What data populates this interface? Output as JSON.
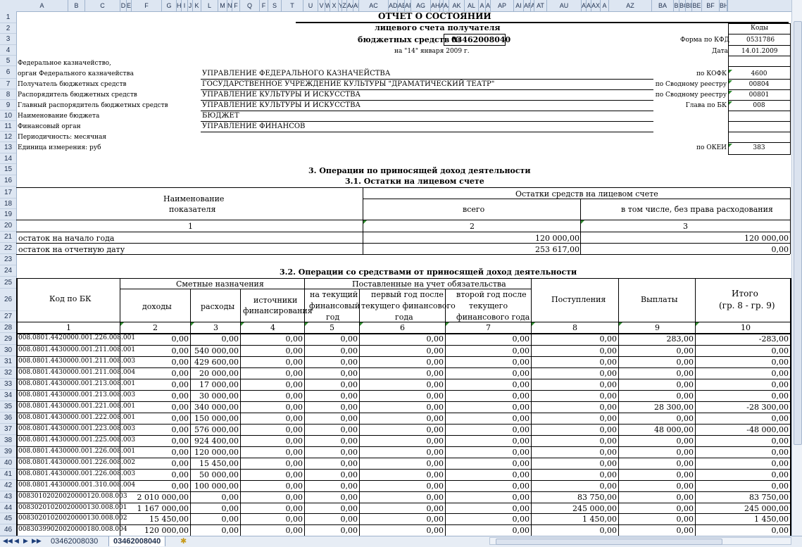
{
  "columns": [
    "A",
    "B",
    "C",
    "D",
    "E",
    "F",
    "G",
    "H",
    "I",
    "J",
    "K",
    "L",
    "M",
    "N",
    "F",
    "Q",
    "F",
    "S",
    "T",
    "U",
    "V",
    "W",
    "X",
    "Y",
    "Z",
    "AA",
    "AB",
    "AC",
    "AD",
    "AE",
    "AF",
    "AG",
    "AH",
    "AI",
    "AJ",
    "AK",
    "AL",
    "A",
    "AI",
    "AP",
    "AI",
    "AR",
    "A",
    "AT",
    "AU",
    "AV",
    "AW",
    "AX",
    "A",
    "AZ",
    "BA",
    "B",
    "BC",
    "BD",
    "BE",
    "BF",
    "BH",
    "BI"
  ],
  "rows": [
    "1",
    "2",
    "3",
    "4",
    "5",
    "6",
    "7",
    "8",
    "9",
    "10",
    "11",
    "12",
    "13",
    "14",
    "15",
    "16",
    "17",
    "18",
    "19",
    "20",
    "21",
    "22",
    "23",
    "24",
    "25",
    "26",
    "27",
    "28",
    "29",
    "30",
    "31",
    "32",
    "33",
    "34",
    "35",
    "36",
    "37",
    "38",
    "39",
    "40",
    "41",
    "42",
    "43",
    "44",
    "45",
    "46"
  ],
  "header": {
    "title": "ОТЧЕТ О СОСТОЯНИИ",
    "subtitle": "лицевого счета получателя",
    "account_label": "бюджетных средств №",
    "account_number": "03462008040",
    "date_line": "на \"14\" января 2009 г.",
    "codes_label": "Коды",
    "form_label": "Форма по КФД",
    "form_code": "0531786",
    "date_label": "Дата",
    "date_value": "14.01.2009"
  },
  "info": [
    {
      "label": "Федеральное казначейство,",
      "value": "",
      "code_label": "",
      "code": ""
    },
    {
      "label": "орган Федерального казначейства",
      "value": "УПРАВЛЕНИЕ ФЕДЕРАЛЬНОГО КАЗНАЧЕЙСТВА",
      "code_label": "по КОФК",
      "code": "4600"
    },
    {
      "label": "Получатель бюджетных средств",
      "value": "ГОСУДАРСТВЕННОЕ УЧРЕЖДЕНИЕ КУЛЬТУРЫ \"ДРАМАТИЧЕСКИЙ ТЕАТР\"",
      "code_label": "по Сводному реестру",
      "code": "00804"
    },
    {
      "label": "Распорядитель бюджетных средств",
      "value": "УПРАВЛЕНИЕ КУЛЬТУРЫ И ИСКУССТВА",
      "code_label": "по Сводному реестру",
      "code": "00801"
    },
    {
      "label": "Главный распорядитель бюджетных средств",
      "value": "УПРАВЛЕНИЕ КУЛЬТУРЫ И ИСКУССТВА",
      "code_label": "Глава по БК",
      "code": "008"
    },
    {
      "label": "Наименование бюджета",
      "value": "БЮДЖЕТ",
      "code_label": "",
      "code": ""
    },
    {
      "label": "Финансовый орган",
      "value": "УПРАВЛЕНИЕ ФИНАНСОВ",
      "code_label": "",
      "code": ""
    },
    {
      "label": "Периодичность: месячная",
      "value": "",
      "code_label": "",
      "code": ""
    },
    {
      "label": "Единица измерения: руб",
      "value": "",
      "code_label": "по ОКЕИ",
      "code": "383"
    }
  ],
  "section3": {
    "title": "3. Операции по приносящей доход деятельности",
    "sub31": "3.1. Остатки на лицевом счете",
    "name_header_1": "Наименование",
    "name_header_2": "показателя",
    "balances_header": "Остатки средств на лицевом счете",
    "total_header": "всего",
    "restricted_header": "в том числе, без права расходования",
    "col_nums": [
      "1",
      "2",
      "3"
    ],
    "rows": [
      {
        "label": "остаток на начало года",
        "total": "120 000,00",
        "restricted": "120 000,00"
      },
      {
        "label": "остаток на отчетную дату",
        "total": "253 617,00",
        "restricted": "0,00"
      }
    ]
  },
  "section32": {
    "title": "3.2. Операции со средствами от приносящей доход деятельности",
    "code_header": "Код по БК",
    "estimate_header": "Сметные назначения",
    "obligations_header": "Поставленные на учет обязательства",
    "income_header": "доходы",
    "expenses_header": "расходы",
    "sources_header_1": "источники",
    "sources_header_2": "финансирования",
    "cur_year_1": "на текущий",
    "cur_year_2": "финансовый",
    "cur_year_3": "год",
    "first_year_1": "первый год после",
    "first_year_2": "текущего финансового",
    "first_year_3": "года",
    "second_year_1": "второй год после",
    "second_year_2": "текущего",
    "second_year_3": "финансового года",
    "receipts_header": "Поступления",
    "payments_header": "Выплаты",
    "total_header_1": "Итого",
    "total_header_2": "(гр. 8 - гр. 9)",
    "col_nums": [
      "1",
      "2",
      "3",
      "4",
      "5",
      "6",
      "7",
      "8",
      "9",
      "10"
    ],
    "rows": [
      [
        "008.0801.4420000.001.226.008.001",
        "0,00",
        "0,00",
        "0,00",
        "0,00",
        "0,00",
        "0,00",
        "0,00",
        "283,00",
        "-283,00"
      ],
      [
        "008.0801.4430000.001.211.008.001",
        "0,00",
        "540 000,00",
        "0,00",
        "0,00",
        "0,00",
        "0,00",
        "0,00",
        "0,00",
        "0,00"
      ],
      [
        "008.0801.4430000.001.211.008.003",
        "0,00",
        "429 600,00",
        "0,00",
        "0,00",
        "0,00",
        "0,00",
        "0,00",
        "0,00",
        "0,00"
      ],
      [
        "008.0801.4430000.001.211.008.004",
        "0,00",
        "20 000,00",
        "0,00",
        "0,00",
        "0,00",
        "0,00",
        "0,00",
        "0,00",
        "0,00"
      ],
      [
        "008.0801.4430000.001.213.008.001",
        "0,00",
        "17 000,00",
        "0,00",
        "0,00",
        "0,00",
        "0,00",
        "0,00",
        "0,00",
        "0,00"
      ],
      [
        "008.0801.4430000.001.213.008.003",
        "0,00",
        "30 000,00",
        "0,00",
        "0,00",
        "0,00",
        "0,00",
        "0,00",
        "0,00",
        "0,00"
      ],
      [
        "008.0801.4430000.001.221.008.001",
        "0,00",
        "340 000,00",
        "0,00",
        "0,00",
        "0,00",
        "0,00",
        "0,00",
        "28 300,00",
        "-28 300,00"
      ],
      [
        "008.0801.4430000.001.222.008.001",
        "0,00",
        "150 000,00",
        "0,00",
        "0,00",
        "0,00",
        "0,00",
        "0,00",
        "0,00",
        "0,00"
      ],
      [
        "008.0801.4430000.001.223.008.003",
        "0,00",
        "576 000,00",
        "0,00",
        "0,00",
        "0,00",
        "0,00",
        "0,00",
        "48 000,00",
        "-48 000,00"
      ],
      [
        "008.0801.4430000.001.225.008.003",
        "0,00",
        "924 400,00",
        "0,00",
        "0,00",
        "0,00",
        "0,00",
        "0,00",
        "0,00",
        "0,00"
      ],
      [
        "008.0801.4430000.001.226.008.001",
        "0,00",
        "120 000,00",
        "0,00",
        "0,00",
        "0,00",
        "0,00",
        "0,00",
        "0,00",
        "0,00"
      ],
      [
        "008.0801.4430000.001.226.008.002",
        "0,00",
        "15 450,00",
        "0,00",
        "0,00",
        "0,00",
        "0,00",
        "0,00",
        "0,00",
        "0,00"
      ],
      [
        "008.0801.4430000.001.226.008.003",
        "0,00",
        "50 000,00",
        "0,00",
        "0,00",
        "0,00",
        "0,00",
        "0,00",
        "0,00",
        "0,00"
      ],
      [
        "008.0801.4430000.001.310.008.004",
        "0,00",
        "100 000,00",
        "0,00",
        "0,00",
        "0,00",
        "0,00",
        "0,00",
        "0,00",
        "0,00"
      ],
      [
        "00830102020020000120.008.003",
        "2 010 000,00",
        "0,00",
        "0,00",
        "0,00",
        "0,00",
        "0,00",
        "83 750,00",
        "0,00",
        "83 750,00"
      ],
      [
        "00830201020020000130.008.001",
        "1 167 000,00",
        "0,00",
        "0,00",
        "0,00",
        "0,00",
        "0,00",
        "245 000,00",
        "0,00",
        "245 000,00"
      ],
      [
        "00830201020020000130.008.002",
        "15 450,00",
        "0,00",
        "0,00",
        "0,00",
        "0,00",
        "0,00",
        "1 450,00",
        "0,00",
        "1 450,00"
      ],
      [
        "00830399020020000180.008.004",
        "120 000,00",
        "0,00",
        "0,00",
        "0,00",
        "0,00",
        "0,00",
        "0,00",
        "0,00",
        "0,00"
      ]
    ]
  },
  "tabs": {
    "nav": [
      "◀◀",
      "◀",
      "▶",
      "▶▶"
    ],
    "sheet1": "03462008030",
    "sheet2": "03462008040",
    "new_sheet": "✱"
  }
}
